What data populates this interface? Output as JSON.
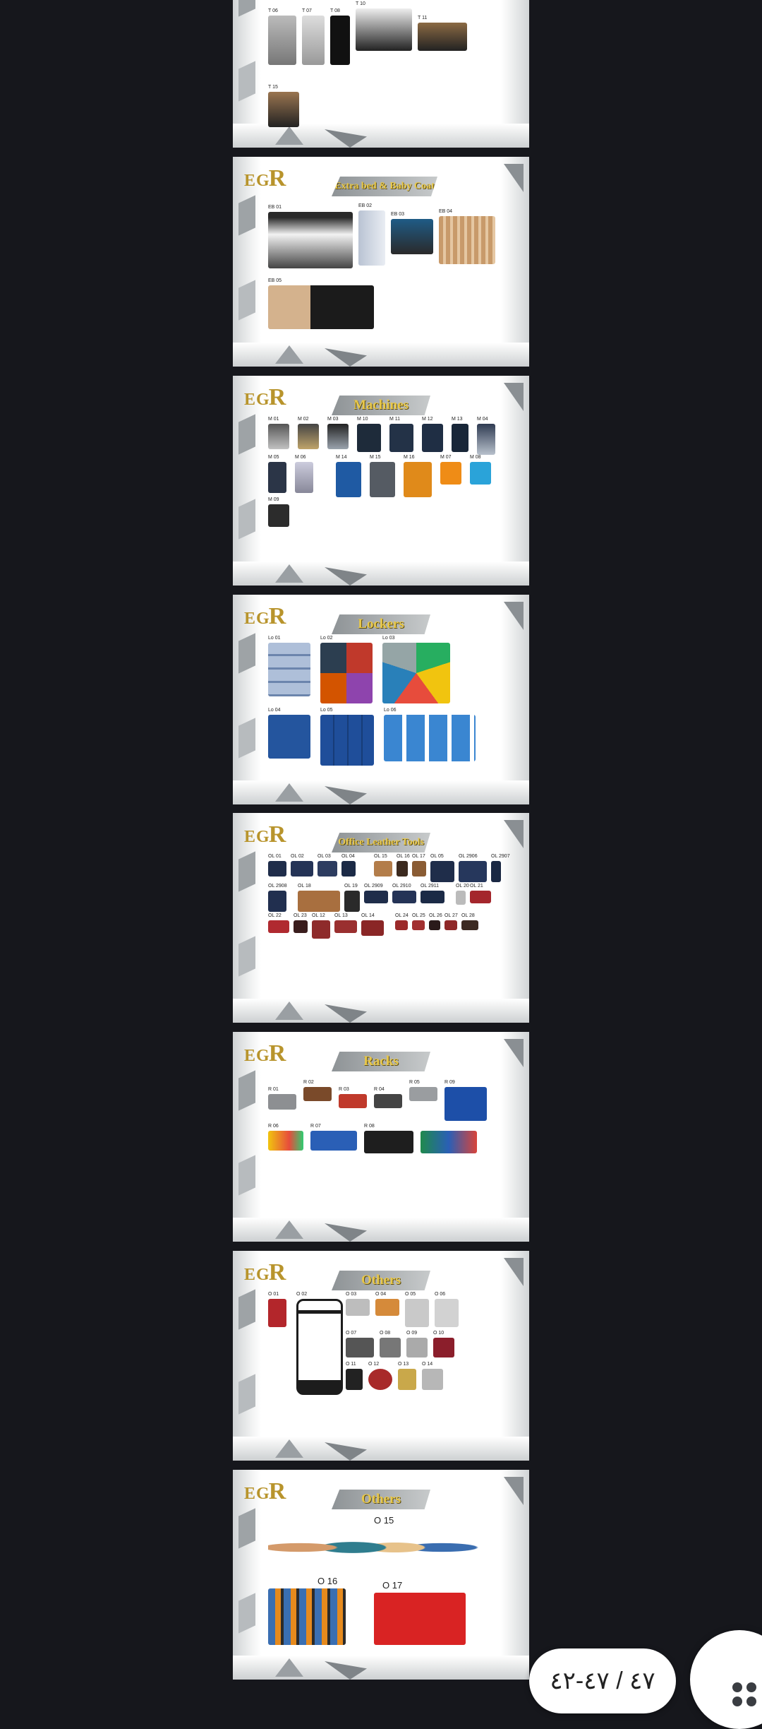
{
  "pages": [
    {
      "title": "",
      "items": [
        "T 06",
        "T 07",
        "T 08",
        "T 10",
        "T 11",
        "T 15"
      ]
    },
    {
      "title": "Extra bed & Baby Coat",
      "items": [
        "EB 01",
        "EB 02",
        "EB 03",
        "EB 04",
        "EB 05"
      ]
    },
    {
      "title": "Machines",
      "items": [
        "M 01",
        "M 02",
        "M 03",
        "M 04",
        "M 05",
        "M 06",
        "M 07",
        "M 08",
        "M 09",
        "M 10",
        "M 11",
        "M 12",
        "M 13",
        "M 14",
        "M 15",
        "M 16"
      ]
    },
    {
      "title": "Lockers",
      "items": [
        "Lo 01",
        "Lo 02",
        "Lo 03",
        "Lo 04",
        "Lo 05",
        "Lo 06"
      ]
    },
    {
      "title": "Office Leather Tools",
      "items": [
        "OL 01",
        "OL 02",
        "OL 03",
        "OL 04",
        "OL 05",
        "OL 2906",
        "OL 2907",
        "OL 2908",
        "OL 2909",
        "OL 2910",
        "OL 2911",
        "OL 12",
        "OL 13",
        "OL 14",
        "OL 15",
        "OL 16",
        "OL 17",
        "OL 18",
        "OL 19",
        "OL 20",
        "OL 21",
        "OL 22",
        "OL 23",
        "OL 24",
        "OL 25",
        "OL 26",
        "OL 27",
        "OL 28"
      ]
    },
    {
      "title": "Racks",
      "items": [
        "R 01",
        "R 02",
        "R 03",
        "R 04",
        "R 05",
        "R 06",
        "R 07",
        "R 08",
        "R 09"
      ]
    },
    {
      "title": "Others",
      "items": [
        "O 01",
        "O 02",
        "O 03",
        "O 04",
        "O 05",
        "O 06",
        "O 07",
        "O 08",
        "O 09",
        "O 10",
        "O 11",
        "O 12",
        "O 13",
        "O 14"
      ]
    },
    {
      "title": "Others",
      "items": [
        "O 15",
        "O 16",
        "O 17"
      ]
    }
  ],
  "logo": {
    "text": "EG",
    "r": "R"
  },
  "pager": {
    "label": "٤٧ / ٤٧-٤٢"
  },
  "colors": {
    "background": "#16171c",
    "brand_gold": "#b8942c",
    "banner_grey": "#8e9396"
  },
  "icons": {
    "fab": "grid-dots-icon"
  }
}
